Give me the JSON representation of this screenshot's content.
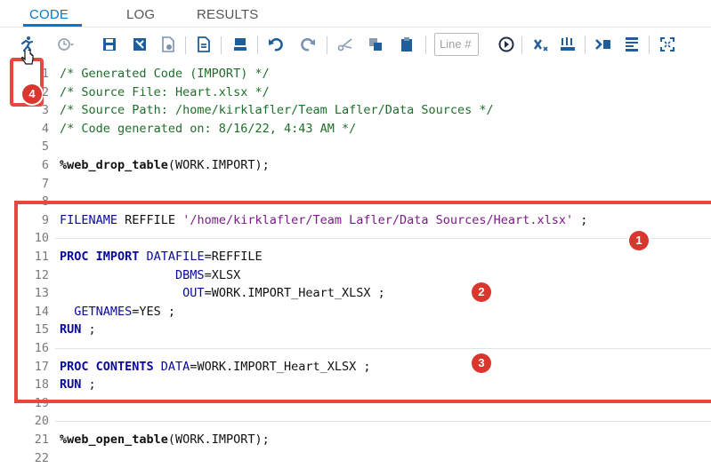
{
  "tabs": [
    {
      "label": "CODE",
      "active": true
    },
    {
      "label": "LOG",
      "active": false
    },
    {
      "label": "RESULTS",
      "active": false
    }
  ],
  "toolbar": {
    "line_placeholder": "Line #",
    "icons": [
      "run-icon",
      "history-icon",
      "save-icon",
      "save-as-icon",
      "export-icon",
      "copy-icon",
      "submit-icon",
      "undo-icon",
      "redo-icon",
      "cut-icon",
      "copy-text-icon",
      "paste-icon",
      "go-icon",
      "clear-icon",
      "format-code-icon",
      "add-snippet-icon",
      "options-icon",
      "maximize-icon"
    ]
  },
  "callouts": [
    "1",
    "2",
    "3",
    "4"
  ],
  "colors": {
    "accent": "#0378cd",
    "highlight": "#e8473f",
    "badge": "#d9372e"
  },
  "code_lines": [
    {
      "n": "1",
      "segs": [
        {
          "t": "cm",
          "v": "/* Generated Code (IMPORT) */"
        }
      ]
    },
    {
      "n": "2",
      "segs": [
        {
          "t": "cm",
          "v": "/* Source File: Heart.xlsx */"
        }
      ]
    },
    {
      "n": "3",
      "segs": [
        {
          "t": "cm",
          "v": "/* Source Path: /home/kirklafler/Team Lafler/Data Sources */"
        }
      ]
    },
    {
      "n": "4",
      "segs": [
        {
          "t": "cm",
          "v": "/* Code generated on: 8/16/22, 4:43 AM */"
        }
      ]
    },
    {
      "n": "5",
      "segs": []
    },
    {
      "n": "6",
      "segs": [
        {
          "t": "mac",
          "v": "%web_drop_table"
        },
        {
          "t": "txt",
          "v": "(WORK.IMPORT);"
        }
      ]
    },
    {
      "n": "7",
      "segs": []
    },
    {
      "n": "8",
      "segs": []
    },
    {
      "n": "9",
      "segs": [
        {
          "t": "kw2",
          "v": "FILENAME "
        },
        {
          "t": "txt",
          "v": "REFFILE "
        },
        {
          "t": "str",
          "v": "'/home/kirklafler/Team Lafler/Data Sources/Heart.xlsx'"
        },
        {
          "t": "txt",
          "v": " ;"
        }
      ]
    },
    {
      "n": "10",
      "segs": []
    },
    {
      "n": "11",
      "segs": [
        {
          "t": "kw",
          "v": "PROC IMPORT "
        },
        {
          "t": "kw2",
          "v": "DATAFILE"
        },
        {
          "t": "txt",
          "v": "=REFFILE"
        }
      ]
    },
    {
      "n": "12",
      "segs": [
        {
          "t": "txt",
          "v": "                "
        },
        {
          "t": "kw2",
          "v": "DBMS"
        },
        {
          "t": "txt",
          "v": "=XLSX"
        }
      ]
    },
    {
      "n": "13",
      "segs": [
        {
          "t": "txt",
          "v": "                 "
        },
        {
          "t": "kw2",
          "v": "OUT"
        },
        {
          "t": "txt",
          "v": "=WORK.IMPORT_Heart_XLSX ;"
        }
      ]
    },
    {
      "n": "14",
      "segs": [
        {
          "t": "txt",
          "v": "  "
        },
        {
          "t": "kw2",
          "v": "GETNAMES"
        },
        {
          "t": "txt",
          "v": "=YES ;"
        }
      ]
    },
    {
      "n": "15",
      "segs": [
        {
          "t": "kw",
          "v": "RUN"
        },
        {
          "t": "txt",
          "v": " ;"
        }
      ]
    },
    {
      "n": "16",
      "segs": []
    },
    {
      "n": "17",
      "segs": [
        {
          "t": "kw",
          "v": "PROC CONTENTS "
        },
        {
          "t": "kw2",
          "v": "DATA"
        },
        {
          "t": "txt",
          "v": "=WORK.IMPORT_Heart_XLSX ;"
        }
      ]
    },
    {
      "n": "18",
      "segs": [
        {
          "t": "kw",
          "v": "RUN"
        },
        {
          "t": "txt",
          "v": " ;"
        }
      ]
    },
    {
      "n": "19",
      "segs": []
    },
    {
      "n": "20",
      "segs": []
    },
    {
      "n": "21",
      "segs": [
        {
          "t": "mac",
          "v": "%web_open_table"
        },
        {
          "t": "txt",
          "v": "(WORK.IMPORT);"
        }
      ]
    },
    {
      "n": "22",
      "segs": []
    }
  ]
}
